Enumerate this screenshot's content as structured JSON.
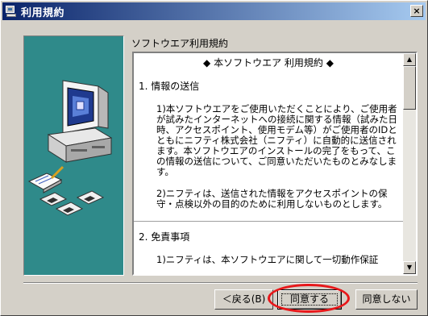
{
  "window": {
    "title": "利用規約",
    "close_label": "×"
  },
  "section_label": "ソフトウエア利用規約",
  "agreement": {
    "title": "◆ 本ソフトウエア 利用規約 ◆",
    "sections": [
      {
        "heading": "1. 情報の送信",
        "paragraphs": [
          "1)本ソフトウエアをご使用いただくことにより、ご使用者が試みたインターネットへの接続に関する情報（試みた日時、アクセスポイント、使用モデム等）がご使用者のIDとともにニフティ株式会社（ニフティ）に自動的に送信されます。本ソフトウエアのインストールの完了をもって、この情報の送信について、ご同意いただいたものとみなします。",
          "2)ニフティは、送信された情報をアクセスポイントの保守・点検以外の目的のために利用しないものとします。"
        ]
      },
      {
        "heading": "2. 免責事項",
        "paragraphs": [
          "1)ニフティは、本ソフトウエアに関して一切動作保証"
        ]
      }
    ]
  },
  "buttons": {
    "back": "＜戻る(B)",
    "agree": "同意する",
    "disagree": "同意しない"
  },
  "scrollbar": {
    "up_arrow": "▲",
    "down_arrow": "▼"
  },
  "colors": {
    "titlebar_start": "#0a246a",
    "titlebar_end": "#a6caf0",
    "panel_bg": "#d4d0c8",
    "art_bg": "#2f8a8a",
    "highlight": "#e8171a"
  }
}
